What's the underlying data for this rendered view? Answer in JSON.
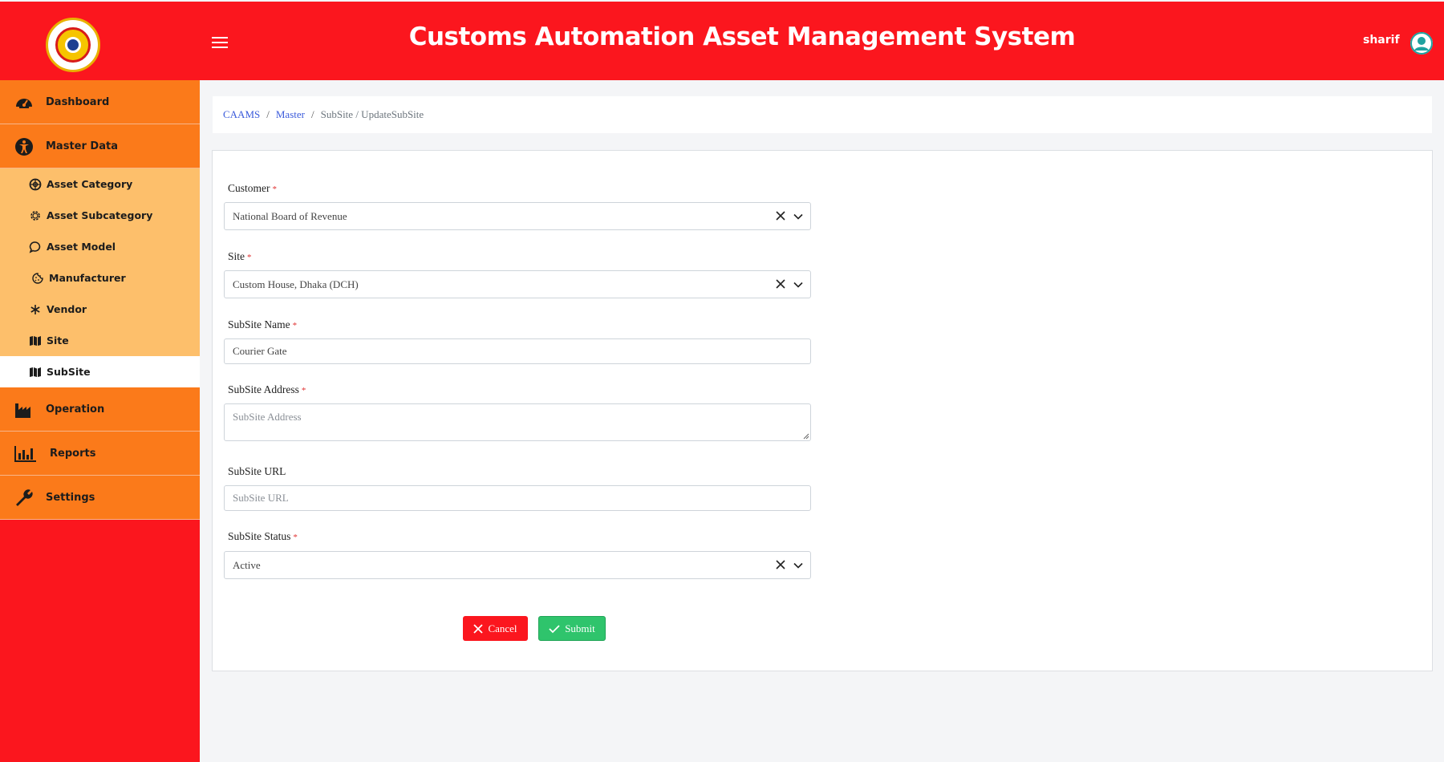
{
  "header": {
    "title": "Customs Automation Asset Management System",
    "username": "sharif"
  },
  "sidebar": {
    "main_items": [
      {
        "label": "Dashboard",
        "icon": "dashboard-gauge-icon"
      },
      {
        "label": "Master Data",
        "icon": "accessibility-icon"
      }
    ],
    "master_subitems": [
      {
        "label": "Asset Category",
        "icon": "lifebuoy-icon"
      },
      {
        "label": "Asset Subcategory",
        "icon": "gear-icon"
      },
      {
        "label": "Asset Model",
        "icon": "chat-bubble-icon"
      },
      {
        "label": "Manufacturer",
        "icon": "cookie-icon"
      },
      {
        "label": "Vendor",
        "icon": "snowflake-icon"
      },
      {
        "label": "Site",
        "icon": "map-icon"
      },
      {
        "label": "SubSite",
        "icon": "map-icon"
      }
    ],
    "other_items": [
      {
        "label": "Operation",
        "icon": "industry-icon"
      },
      {
        "label": "Reports",
        "icon": "bar-chart-icon"
      },
      {
        "label": "Settings",
        "icon": "wrench-icon"
      }
    ]
  },
  "breadcrumb": {
    "root": "CAAMS",
    "section": "Master",
    "current": "SubSite / UpdateSubSite",
    "separator": "/"
  },
  "form": {
    "customer": {
      "label": "Customer",
      "required": "*",
      "value": "National Board of Revenue"
    },
    "site": {
      "label": "Site",
      "required": "*",
      "value": "Custom House, Dhaka (DCH)"
    },
    "subsite_name": {
      "label": "SubSite Name",
      "required": "*",
      "value": "Courier Gate"
    },
    "subsite_address": {
      "label": "SubSite Address",
      "required": "*",
      "placeholder": "SubSite Address"
    },
    "subsite_url": {
      "label": "SubSite URL",
      "placeholder": "SubSite URL"
    },
    "subsite_status": {
      "label": "SubSite Status",
      "required": "*",
      "value": "Active"
    },
    "cancel_label": "Cancel",
    "submit_label": "Submit"
  },
  "colors": {
    "header_bg": "#fb161e",
    "sidebar_main": "#fb7a1a",
    "sidebar_sub": "#fdbf6b",
    "cancel": "#fb161e",
    "submit": "#2fc46c",
    "link": "#3b5bdb"
  }
}
